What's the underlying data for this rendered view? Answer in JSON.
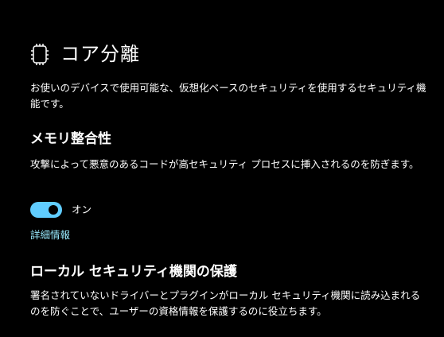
{
  "header": {
    "icon": "core-isolation-chip-icon",
    "title": "コア分離"
  },
  "intro": {
    "description": "お使いのデバイスで使用可能な、仮想化ベースのセキュリティを使用するセキュリティ機能です。"
  },
  "memory_integrity": {
    "heading": "メモリ整合性",
    "description": "攻撃によって悪意のあるコードが高セキュリティ プロセスに挿入されるのを防ぎます。",
    "toggle_state": "on",
    "toggle_label": "オン",
    "learn_more": "詳細情報"
  },
  "lsa_protection": {
    "heading": "ローカル セキュリティ機関の保護",
    "description": "署名されていないドライバーとプラグインがローカル セキュリティ機関に読み込まれるのを防ぐことで、ユーザーの資格情報を保護するのに役立ちます。"
  },
  "colors": {
    "background": "#000000",
    "accent": "#60cdff",
    "link": "#99ebff",
    "text": "#ffffff"
  }
}
